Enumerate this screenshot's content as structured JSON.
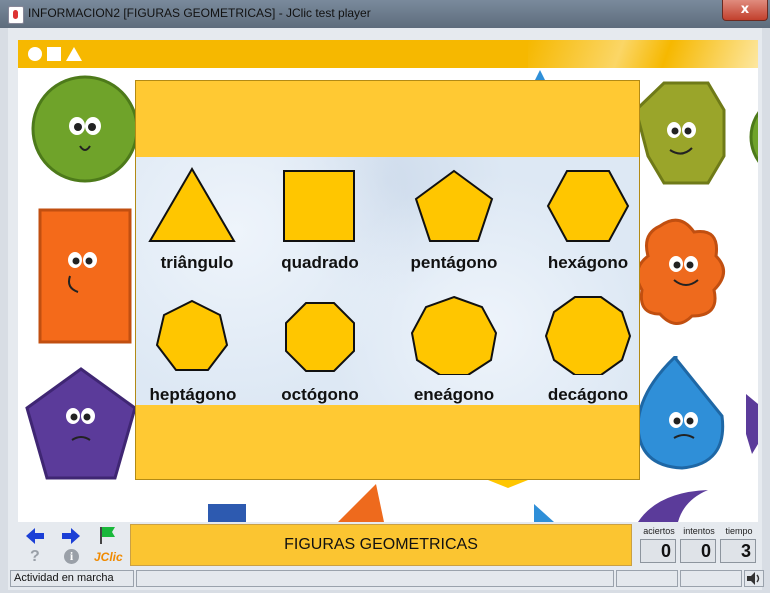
{
  "window": {
    "title": "INFORMACION2 [FIGURAS GEOMETRICAS] - JClic test player",
    "close_label": "x"
  },
  "shapes": [
    {
      "label": "triângulo",
      "icon": "triangle-icon"
    },
    {
      "label": "quadrado",
      "icon": "square-icon"
    },
    {
      "label": "pentágono",
      "icon": "pentagon-icon"
    },
    {
      "label": "hexágono",
      "icon": "hexagon-icon"
    },
    {
      "label": "heptágono",
      "icon": "heptagon-icon"
    },
    {
      "label": "octógono",
      "icon": "octagon-icon"
    },
    {
      "label": "eneágono",
      "icon": "nonagon-icon"
    },
    {
      "label": "decágono",
      "icon": "decagon-icon"
    }
  ],
  "message": "FIGURAS GEOMETRICAS",
  "counters": [
    {
      "label": "aciertos",
      "value": "0"
    },
    {
      "label": "intentos",
      "value": "0"
    },
    {
      "label": "tiempo",
      "value": "3"
    }
  ],
  "nav": {
    "back_icon": "arrow-left-icon",
    "forward_icon": "arrow-right-icon",
    "flag_icon": "flag-icon",
    "help_label": "?",
    "info_label": "i",
    "brand_label": "JClic"
  },
  "status": {
    "text": "Actividad en marcha"
  },
  "colors": {
    "accent": "#f6b800",
    "shape_fill": "#ffc600",
    "panel": "#dde8f4"
  }
}
